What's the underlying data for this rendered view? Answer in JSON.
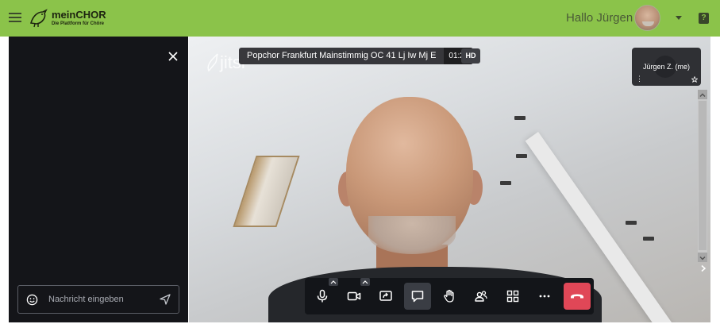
{
  "header": {
    "menu_icon": "hamburger-icon",
    "logo_title": "meinCHOR",
    "logo_subtitle": "Die Plattform für Chöre",
    "greeting": "Hallo Jürgen",
    "help_label": "?",
    "background_color": "#8bc34a"
  },
  "chat": {
    "close_icon": "close-icon",
    "input_placeholder": "Nachricht eingeben",
    "emoji_icon": "smiley-icon",
    "send_icon": "send-icon",
    "panel_color": "#141519"
  },
  "conference": {
    "logo_text": "jitsi",
    "subject": "Popchor Frankfurt Mainstimmig OC 41 Lj Iw Mj E",
    "timer": "01:26",
    "quality_badge": "HD"
  },
  "local_thumbnail": {
    "name": "Jürgen Z. (me)",
    "menu_icon": "vertical-dots-icon",
    "pin_icon": "star-icon"
  },
  "toolbar": {
    "buttons": [
      {
        "name": "microphone",
        "icon": "microphone-icon"
      },
      {
        "name": "camera",
        "icon": "camera-icon"
      },
      {
        "name": "screen-share",
        "icon": "screen-share-icon"
      },
      {
        "name": "chat",
        "icon": "chat-icon",
        "active": true
      },
      {
        "name": "raise-hand",
        "icon": "hand-icon"
      },
      {
        "name": "participants",
        "icon": "participants-icon"
      },
      {
        "name": "tile-view",
        "icon": "grid-icon"
      },
      {
        "name": "more",
        "icon": "more-icon"
      },
      {
        "name": "hangup",
        "icon": "hangup-icon",
        "color": "#e04757"
      }
    ]
  }
}
